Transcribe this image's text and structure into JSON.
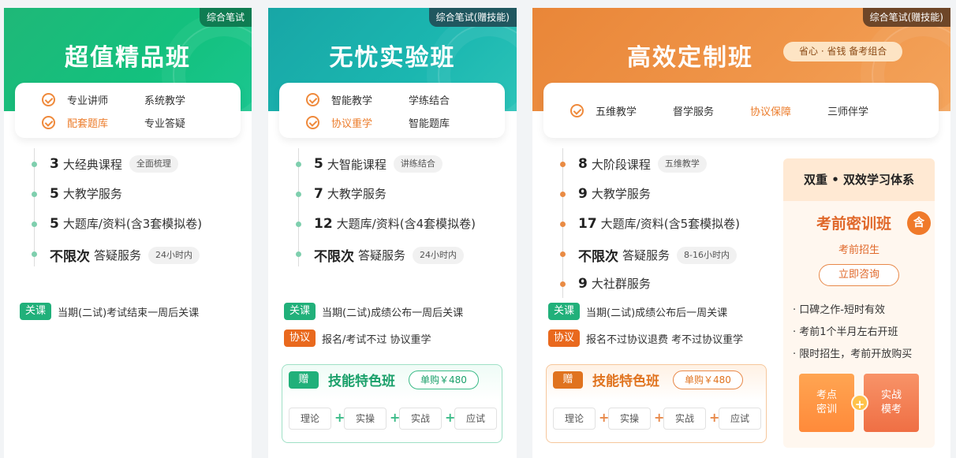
{
  "cards": [
    {
      "tag": "综合笔试",
      "title": "超值精品班",
      "features": [
        "专业讲师",
        "系统教学",
        "配套题库",
        "专业答疑"
      ],
      "items": [
        {
          "num": "3",
          "text": "大经典课程",
          "pill": "全面梳理"
        },
        {
          "num": "5",
          "text": "大教学服务",
          "pill": ""
        },
        {
          "num": "5",
          "text": "大题库/资料(含3套模拟卷)",
          "pill": ""
        },
        {
          "num": "不限次",
          "text": "答疑服务",
          "pill": "24小时内"
        }
      ],
      "policies": [
        {
          "tag": "关课",
          "text": "当期(二试)考试结束一周后关课"
        }
      ]
    },
    {
      "tag": "综合笔试(赠技能)",
      "title": "无忧实验班",
      "features": [
        "智能教学",
        "学练结合",
        "协议重学",
        "智能题库"
      ],
      "items": [
        {
          "num": "5",
          "text": "大智能课程",
          "pill": "讲练结合"
        },
        {
          "num": "7",
          "text": "大教学服务",
          "pill": ""
        },
        {
          "num": "12",
          "text": "大题库/资料(含4套模拟卷)",
          "pill": ""
        },
        {
          "num": "不限次",
          "text": "答疑服务",
          "pill": "24小时内"
        }
      ],
      "policies": [
        {
          "tag": "关课",
          "text": "当期(二试)成绩公布一周后关课"
        },
        {
          "tag": "协议",
          "text": "报名/考试不过 协议重学"
        }
      ],
      "bonus": {
        "badge": "赠",
        "name": "技能特色班",
        "price": "单购￥480",
        "tags": [
          "理论",
          "实操",
          "实战",
          "应试"
        ]
      }
    },
    {
      "tag": "综合笔试(赠技能)",
      "title": "高效定制班",
      "slogan": "省心 · 省钱   备考组合",
      "features": [
        "五维教学",
        "督学服务",
        "协议保障",
        "三师伴学"
      ],
      "items": [
        {
          "num": "8",
          "text": "大阶段课程",
          "pill": "五维教学"
        },
        {
          "num": "9",
          "text": "大教学服务",
          "pill": ""
        },
        {
          "num": "17",
          "text": "大题库/资料(含5套模拟卷)",
          "pill": ""
        },
        {
          "num": "不限次",
          "text": "答疑服务",
          "pill": "8-16小时内"
        },
        {
          "num": "9",
          "text": "大社群服务",
          "pill": ""
        }
      ],
      "policies": [
        {
          "tag": "关课",
          "text": "当期(二试)成绩公布后一周关课"
        },
        {
          "tag": "协议",
          "text": "报名不过协议退费 考不过协议重学"
        }
      ],
      "bonus": {
        "badge": "赠",
        "name": "技能特色班",
        "price": "单购￥480",
        "tags": [
          "理论",
          "实操",
          "实战",
          "应试"
        ]
      },
      "side": {
        "header": "双重 • 双效学习体系",
        "title": "考前密训班",
        "badge": "含",
        "subtitle": "考前招生",
        "button": "立即咨询",
        "bullets": [
          "· 口碑之作-短时有效",
          "· 考前1个半月左右开班",
          "· 限时招生，考前开放购买"
        ],
        "btn_a": "考点\n密训",
        "btn_b": "实战\n模考",
        "plus": "+"
      }
    }
  ],
  "colors": {
    "green": "#1fb878",
    "teal": "#1bb7b0",
    "orange": "#f0964a",
    "accent_orange": "#ec7d2c"
  }
}
